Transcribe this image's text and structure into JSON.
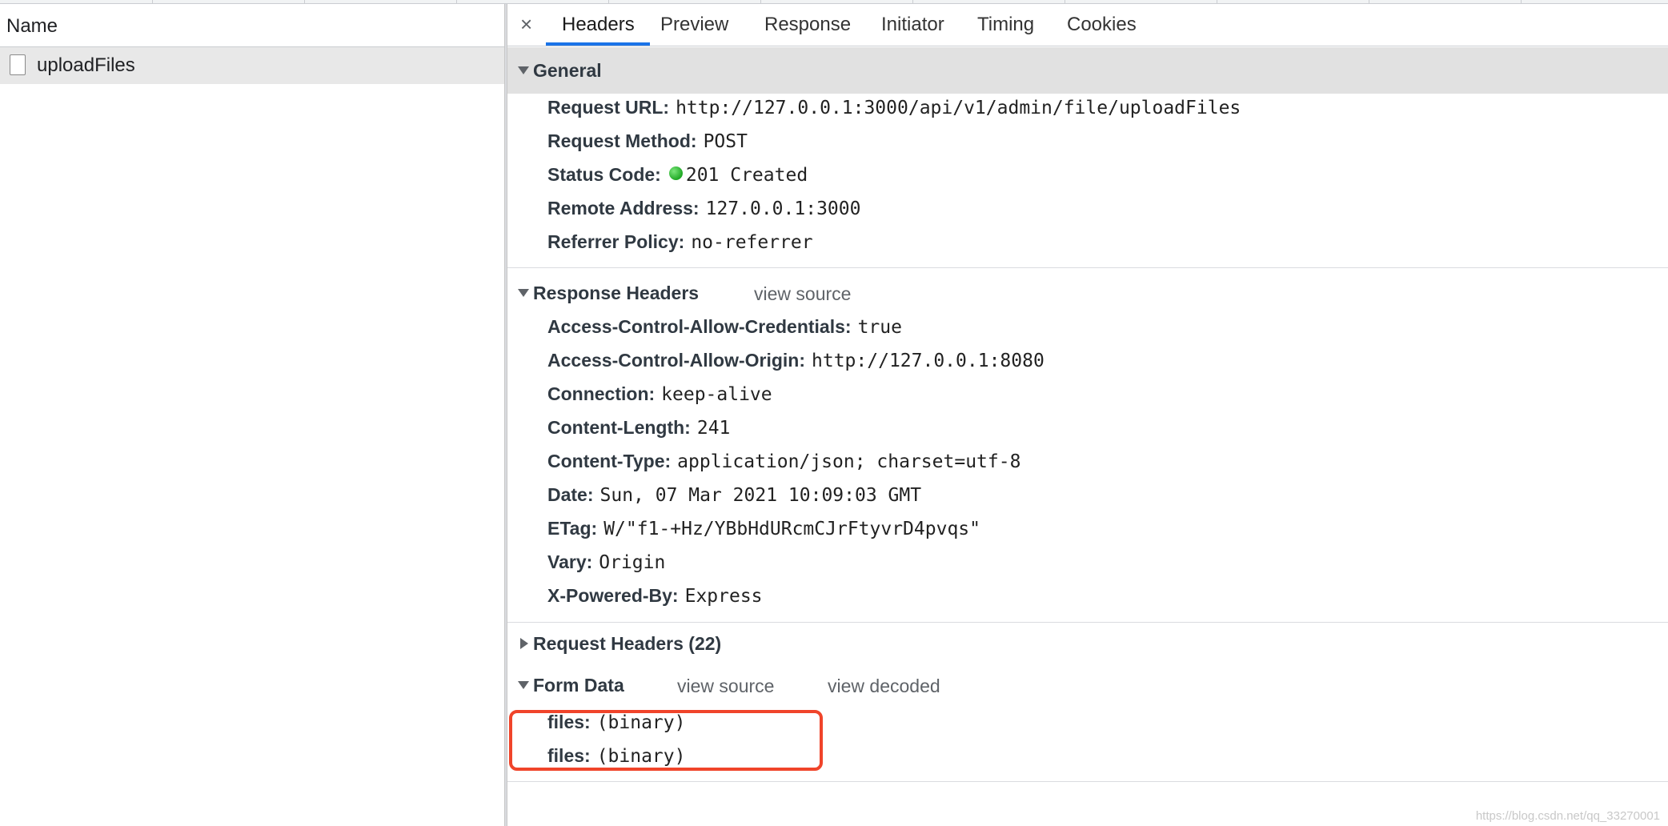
{
  "left_panel": {
    "column_header": "Name",
    "requests": [
      {
        "name": "uploadFiles"
      }
    ]
  },
  "tabs": {
    "close": "×",
    "items": [
      "Headers",
      "Preview",
      "Response",
      "Initiator",
      "Timing",
      "Cookies"
    ],
    "active": "Headers"
  },
  "general": {
    "title": "General",
    "rows": [
      {
        "key": "Request URL:",
        "value": "http://127.0.0.1:3000/api/v1/admin/file/uploadFiles"
      },
      {
        "key": "Request Method:",
        "value": "POST"
      },
      {
        "key": "Status Code:",
        "value": "201 Created"
      },
      {
        "key": "Remote Address:",
        "value": "127.0.0.1:3000"
      },
      {
        "key": "Referrer Policy:",
        "value": "no-referrer"
      }
    ]
  },
  "response_headers": {
    "title": "Response Headers",
    "view_source": "view source",
    "rows": [
      {
        "key": "Access-Control-Allow-Credentials:",
        "value": "true"
      },
      {
        "key": "Access-Control-Allow-Origin:",
        "value": "http://127.0.0.1:8080"
      },
      {
        "key": "Connection:",
        "value": "keep-alive"
      },
      {
        "key": "Content-Length:",
        "value": "241"
      },
      {
        "key": "Content-Type:",
        "value": "application/json; charset=utf-8"
      },
      {
        "key": "Date:",
        "value": "Sun, 07 Mar 2021 10:09:03 GMT"
      },
      {
        "key": "ETag:",
        "value": "W/\"f1-+Hz/YBbHdURcmCJrFtyvrD4pvqs\""
      },
      {
        "key": "Vary:",
        "value": "Origin"
      },
      {
        "key": "X-Powered-By:",
        "value": "Express"
      }
    ]
  },
  "request_headers": {
    "title": "Request Headers (22)"
  },
  "form_data": {
    "title": "Form Data",
    "view_source": "view source",
    "view_decoded": "view decoded",
    "rows": [
      {
        "key": "files:",
        "value": "(binary)"
      },
      {
        "key": "files:",
        "value": "(binary)"
      }
    ]
  },
  "watermark": "https://blog.csdn.net/qq_33270001",
  "colors": {
    "tab_underline": "#1a73e8",
    "status_dot": "#1fa824",
    "highlight_box": "#f0442a",
    "section_bg": "#e1e1e1"
  },
  "icons": {
    "status": "green-circle-icon",
    "collapse": "triangle-down-icon",
    "expand": "triangle-right-icon",
    "file": "document-icon",
    "close": "close-icon"
  }
}
